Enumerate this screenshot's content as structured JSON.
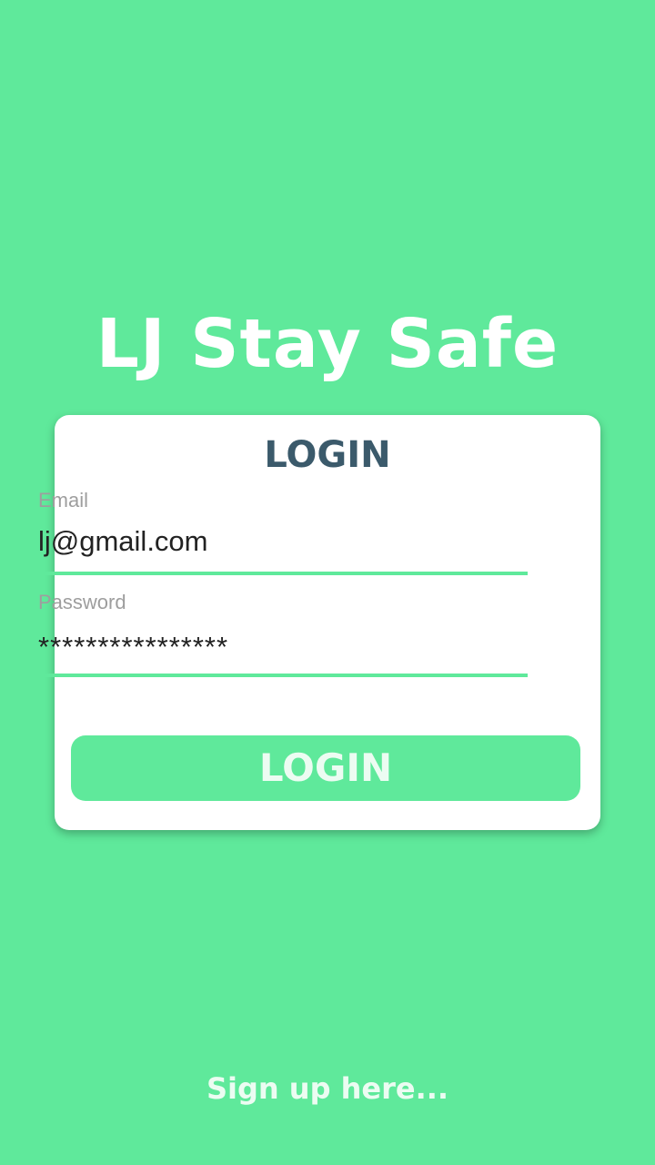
{
  "app": {
    "title": "LJ Stay Safe"
  },
  "login_card": {
    "title": "LOGIN",
    "email": {
      "label": "Email",
      "value": "lj@gmail.com"
    },
    "password": {
      "label": "Password",
      "value": "****************"
    },
    "submit_label": "LOGIN"
  },
  "signup": {
    "link_text": "Sign up here..."
  },
  "colors": {
    "background": "#5fe99b",
    "accent": "#5fe99b",
    "card_title": "#3b5a6b",
    "card": "#ffffff"
  }
}
